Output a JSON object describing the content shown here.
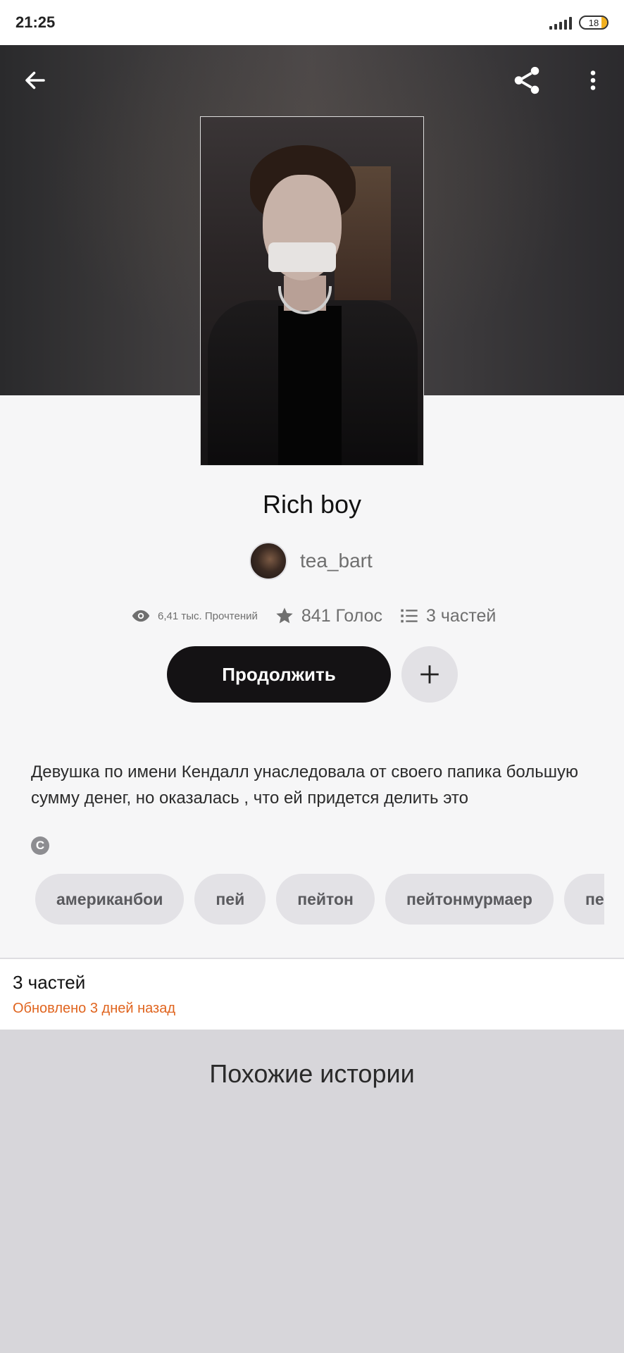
{
  "status_bar": {
    "time": "21:25",
    "battery_level": "18",
    "icons": [
      "signal-icon",
      "battery-icon"
    ]
  },
  "toolbar": {
    "icons": [
      "arrow-left-icon",
      "share-icon",
      "more-vertical-icon"
    ]
  },
  "story": {
    "title": "Rich boy",
    "author": "tea_bart",
    "reads": "6,41 тыс. Прочтений",
    "votes": "841 Голос",
    "parts": "3 частей",
    "continue_label": "Продолжить",
    "description": "Девушка по имени Кендалл унаследовала от своего папика большую сумму денег, но оказалась , что ей придется делить это",
    "copyright_symbol": "C"
  },
  "tags": [
    "американбои",
    "пей",
    "пейтон",
    "пейтонмурмаер",
    "пейтонм"
  ],
  "parts_section": {
    "title": "3 частей",
    "updated": "Обновлено 3 дней назад"
  },
  "similar": {
    "title": "Похожие истории"
  },
  "colors": {
    "accent_orange": "#e0641e",
    "button_dark": "#141214",
    "tag_bg": "#e3e2e6",
    "similar_bg": "#d7d6da"
  }
}
